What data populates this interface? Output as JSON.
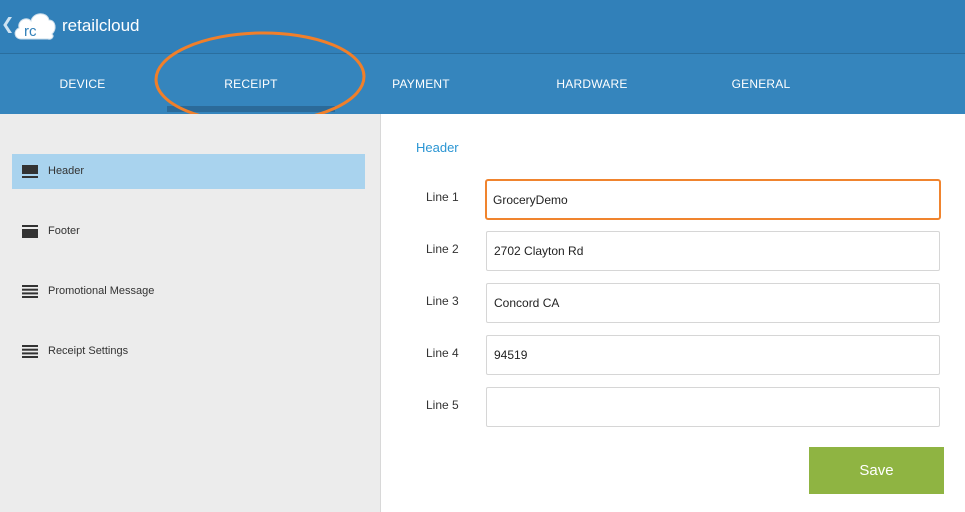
{
  "app": {
    "name": "retailcloud",
    "logo_text": "rc"
  },
  "tabs": [
    {
      "label": "DEVICE"
    },
    {
      "label": "RECEIPT"
    },
    {
      "label": "PAYMENT"
    },
    {
      "label": "HARDWARE"
    },
    {
      "label": "GENERAL"
    }
  ],
  "active_tab": "RECEIPT",
  "sidebar": {
    "items": [
      {
        "label": "Header",
        "icon": "header-icon",
        "active": true
      },
      {
        "label": "Footer",
        "icon": "footer-icon",
        "active": false
      },
      {
        "label": "Promotional Message",
        "icon": "lines-icon",
        "active": false
      },
      {
        "label": "Receipt Settings",
        "icon": "lines-icon",
        "active": false
      }
    ]
  },
  "form": {
    "section_title": "Header",
    "lines": [
      {
        "label": "Line 1",
        "value": "GroceryDemo"
      },
      {
        "label": "Line 2",
        "value": "2702 Clayton Rd"
      },
      {
        "label": "Line 3",
        "value": "Concord CA"
      },
      {
        "label": "Line 4",
        "value": "94519"
      },
      {
        "label": "Line 5",
        "value": ""
      }
    ],
    "save_label": "Save"
  },
  "colors": {
    "topbar": "#3180b9",
    "accent": "#2a95d3",
    "focus": "#f0842e",
    "save": "#8fb442",
    "sidebar_active": "#a9d3ee"
  }
}
